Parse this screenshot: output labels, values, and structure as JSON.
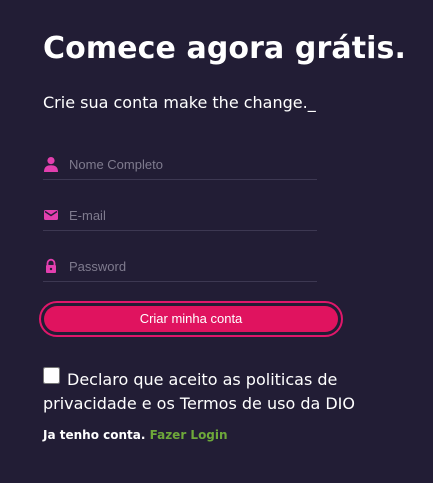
{
  "header": {
    "title": "Comece agora grátis.",
    "subtitle": "Crie sua conta make the change._"
  },
  "form": {
    "name_field": {
      "placeholder": "Nome Completo",
      "value": "",
      "icon": "user-icon"
    },
    "email_field": {
      "placeholder": "E-mail",
      "value": "",
      "icon": "mail-icon"
    },
    "password_field": {
      "placeholder": "Password",
      "value": "",
      "icon": "lock-icon"
    },
    "submit_label": "Criar minha conta",
    "terms_checkbox": {
      "checked": false,
      "label": "Declaro que aceito as politicas de privacidade e os Termos de uso da DIO"
    }
  },
  "footer": {
    "have_account": "Ja tenho conta.",
    "login_link": "Fazer Login"
  },
  "colors": {
    "background": "#221d35",
    "accent": "#e0135f",
    "icon": "#e23fae",
    "link": "#6ea83a",
    "field_line": "#3d3852"
  }
}
